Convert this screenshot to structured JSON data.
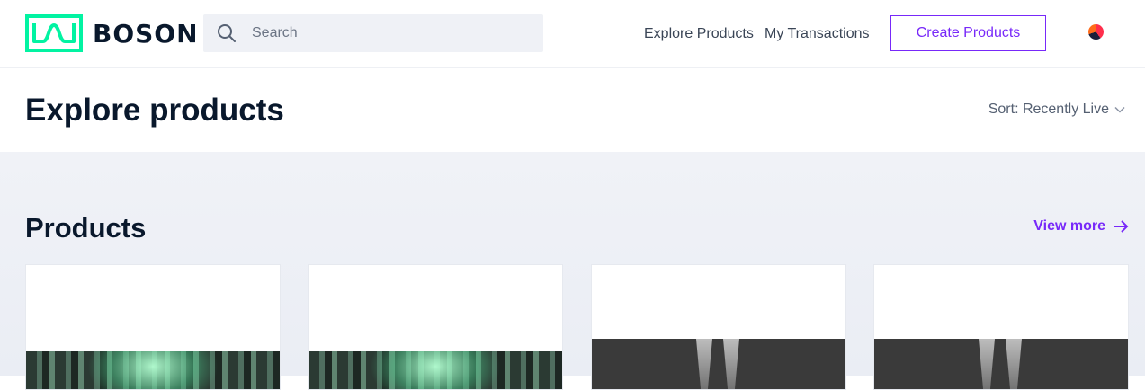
{
  "header": {
    "logo_text": "BOSON",
    "search": {
      "placeholder": "Search",
      "value": ""
    },
    "nav": {
      "explore": "Explore Products",
      "transactions": "My Transactions"
    },
    "create_label": "Create Products",
    "brand_color": "#7829f9",
    "logo_color": "#02f3a2"
  },
  "page": {
    "title": "Explore products",
    "sort_label": "Sort: Recently Live"
  },
  "products_section": {
    "title": "Products",
    "view_more_label": "View more"
  }
}
